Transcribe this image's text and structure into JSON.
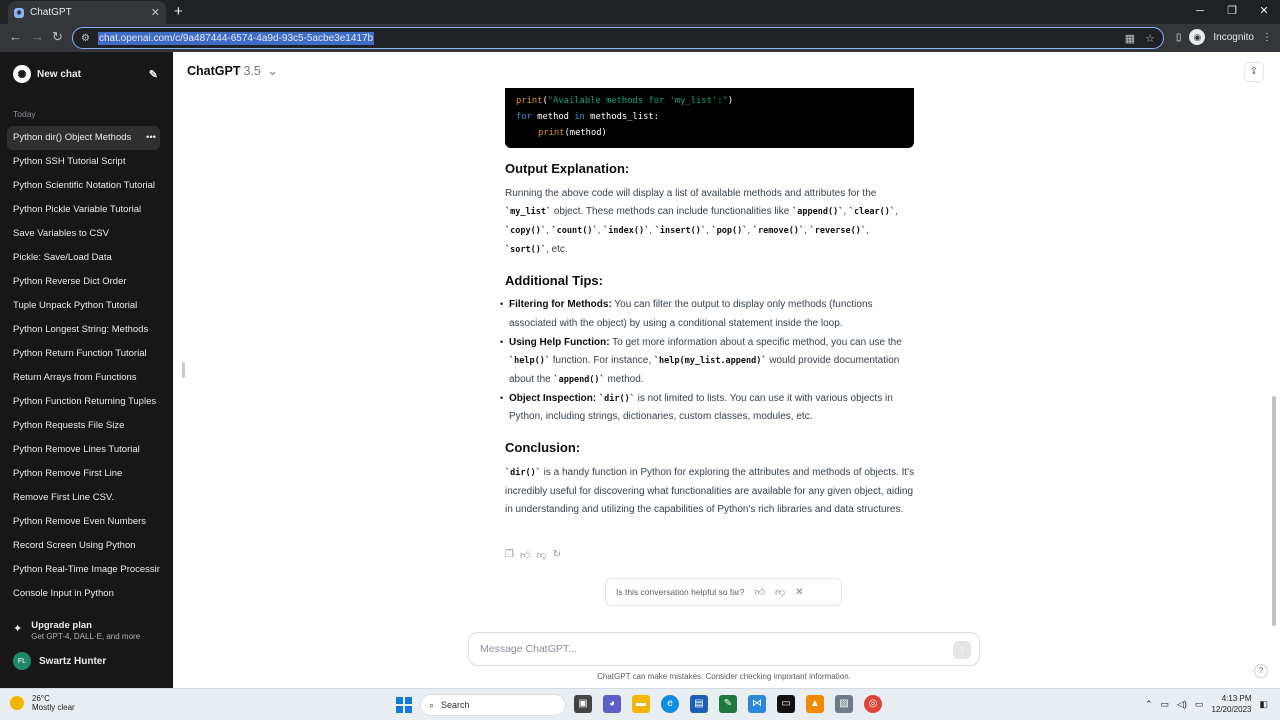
{
  "browser": {
    "tab_title": "ChatGPT",
    "url": "chat.openai.com/c/9a487444-6574-4a9d-93c5-5acbe3e1417b",
    "profile_label": "Incognito"
  },
  "sidebar": {
    "new_chat_label": "New chat",
    "section_today": "Today",
    "items": [
      "Python dir() Object Methods",
      "Python SSH Tutorial Script",
      "Python Scientific Notation Tutorial",
      "Python Pickle Variable Tutorial",
      "Save Variables to CSV",
      "Pickle: Save/Load Data",
      "Python Reverse Dict Order",
      "Tuple Unpack Python Tutorial",
      "Python Longest String: Methods",
      "Python Return Function Tutorial",
      "Return Arrays from Functions",
      "Python Function Returning Tuples",
      "Python Requests File Size",
      "Python Remove Lines Tutorial",
      "Python Remove First Line",
      "Remove First Line CSV.",
      "Python Remove Even Numbers",
      "Record Screen Using Python",
      "Python Real-Time Image Processing",
      "Console Input in Python"
    ],
    "upgrade_title": "Upgrade plan",
    "upgrade_subtitle": "Get GPT-4, DALL·E, and more",
    "user_initials": "FL",
    "user_name": "Swartz Hunter"
  },
  "header": {
    "model_name": "ChatGPT",
    "model_version": "3.5"
  },
  "code": {
    "line1_func": "print",
    "line1_str": "\"Available methods for 'my_list':\"",
    "line2_for": "for",
    "line2_var": " method ",
    "line2_in": "in",
    "line2_rest": " methods_list:",
    "line3_func": "print",
    "line3_rest": "(method)"
  },
  "message": {
    "h_output": "Output Explanation:",
    "p_output_1": "Running the above code will display a list of available methods and attributes for the ",
    "c_mylist": "`my_list`",
    "p_output_2": " object. These methods can include functionalities like ",
    "c_append": "`append()`",
    "c_clear": "`clear()`",
    "c_copy": "`copy()`",
    "c_count": "`count()`",
    "c_index": "`index()`",
    "c_insert": "`insert()`",
    "c_pop": "`pop()`",
    "c_remove": "`remove()`",
    "c_reverse": "`reverse()`",
    "c_sort": "`sort()`",
    "p_output_end": ", etc.",
    "h_tips": "Additional Tips:",
    "tip1_title": "Filtering for Methods:",
    "tip1_text": " You can filter the output to display only methods (functions associated with the object) by using a conditional statement inside the loop.",
    "tip2_title": "Using Help Function:",
    "tip2_text_1": " To get more information about a specific method, you can use the ",
    "tip2_code_help": "`help()`",
    "tip2_text_2": " function. For instance, ",
    "tip2_code_example": "`help(my_list.append)`",
    "tip2_text_3": " would provide documentation about the ",
    "tip2_code_append": "`append()`",
    "tip2_text_4": " method.",
    "tip3_title": "Object Inspection:",
    "tip3_code": "`dir()`",
    "tip3_text": " is not limited to lists. You can use it with various objects in Python, including strings, dictionaries, custom classes, modules, etc.",
    "h_conclusion": "Conclusion:",
    "concl_code": "`dir()`",
    "concl_text": " is a handy function in Python for exploring the attributes and methods of objects. It's incredibly useful for discovering what functionalities are available for any given object, aiding in understanding and utilizing the capabilities of Python's rich libraries and data structures."
  },
  "feedback": {
    "prompt": "Is this conversation helpful so far?"
  },
  "composer": {
    "placeholder": "Message ChatGPT...",
    "disclaimer": "ChatGPT can make mistakes. Consider checking important information."
  },
  "taskbar": {
    "temperature": "26°C",
    "weather": "Mostly clear",
    "search_label": "Search",
    "time": "4:13 PM",
    "date": "12/20/2023"
  }
}
